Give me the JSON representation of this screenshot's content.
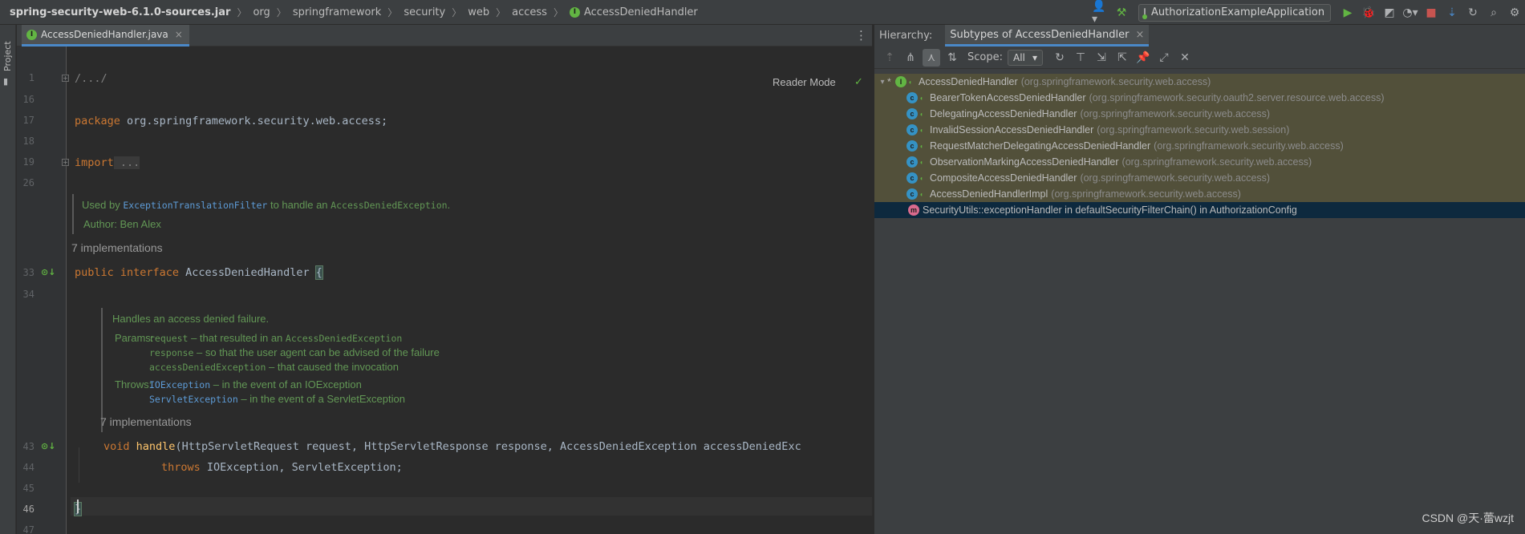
{
  "navbar": {
    "crumbs": [
      "spring-security-web-6.1.0-sources.jar",
      "org",
      "springframework",
      "security",
      "web",
      "access",
      "AccessDeniedHandler"
    ],
    "run_config": "AuthorizationExampleApplication"
  },
  "stripe": {
    "project_label": "Project"
  },
  "editor": {
    "tab_label": "AccessDeniedHandler.java",
    "reader_mode": "Reader Mode",
    "line_numbers": [
      "1",
      "16",
      "17",
      "18",
      "19",
      "26",
      "33",
      "34",
      "43",
      "44",
      "45",
      "46",
      "47"
    ],
    "code": {
      "l1": "/.../",
      "l17_kw": "package",
      "l17_rest": " org.springframework.security.web.access;",
      "l19_kw": "import",
      "l19_rest": " ...",
      "l33_kw": "public interface",
      "l33_name": " AccessDeniedHandler ",
      "l33_brace": "{",
      "l43_kw": "void",
      "l43_fn": "handle",
      "l43_rest": "(HttpServletRequest request, HttpServletResponse response, AccessDeniedException accessDeniedExc",
      "l44_kw": "throws",
      "l44_rest": " IOException, ServletException;",
      "l46": "}"
    },
    "doc1": {
      "used_by": "Used by",
      "filter": "ExceptionTranslationFilter",
      "to_handle": "to handle an",
      "exception": "AccessDeniedException",
      "dot": ".",
      "author": "Author: Ben Alex"
    },
    "impl1": "7 implementations",
    "doc2": {
      "summary": "Handles an access denied failure.",
      "params_label": "Params:",
      "p1_name": "request",
      "p1_text": "– that resulted in an",
      "p1_type": "AccessDeniedException",
      "p2_name": "response",
      "p2_text": "– so that the user agent can be advised of the failure",
      "p3_name": "accessDeniedException",
      "p3_text": "– that caused the invocation",
      "throws_label": "Throws:",
      "t1_name": "IOException",
      "t1_text": "– in the event of an IOException",
      "t2_name": "ServletException",
      "t2_text": "– in the event of a ServletException"
    },
    "impl2": "7 implementations"
  },
  "hierarchy": {
    "label": "Hierarchy:",
    "tab": "Subtypes of AccessDeniedHandler",
    "scope_label": "Scope:",
    "scope_value": "All",
    "root": {
      "name": "AccessDeniedHandler",
      "pkg": "(org.springframework.security.web.access)"
    },
    "items": [
      {
        "name": "BearerTokenAccessDeniedHandler",
        "pkg": "(org.springframework.security.oauth2.server.resource.web.access)"
      },
      {
        "name": "DelegatingAccessDeniedHandler",
        "pkg": "(org.springframework.security.web.access)"
      },
      {
        "name": "InvalidSessionAccessDeniedHandler",
        "pkg": "(org.springframework.security.web.session)"
      },
      {
        "name": "RequestMatcherDelegatingAccessDeniedHandler",
        "pkg": "(org.springframework.security.web.access)"
      },
      {
        "name": "ObservationMarkingAccessDeniedHandler",
        "pkg": "(org.springframework.security.web.access)"
      },
      {
        "name": "CompositeAccessDeniedHandler",
        "pkg": "(org.springframework.security.web.access)"
      },
      {
        "name": "AccessDeniedHandlerImpl",
        "pkg": "(org.springframework.security.web.access)"
      }
    ],
    "lambda": "SecurityUtils::exceptionHandler in defaultSecurityFilterChain() in AuthorizationConfig"
  },
  "watermark": "CSDN @天·蕾wzjt"
}
